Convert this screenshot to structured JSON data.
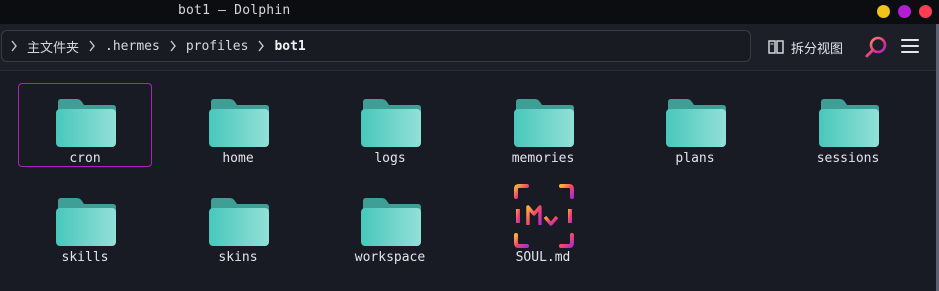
{
  "window": {
    "title": "bot1 — Dolphin",
    "controls": [
      "minimize",
      "maximize",
      "close"
    ],
    "colors": {
      "minimize": "#f2c318",
      "maximize": "#b21fd3",
      "close": "#ff3d52"
    }
  },
  "breadcrumb": {
    "segments": [
      "主文件夹",
      ".hermes",
      "profiles",
      "bot1"
    ]
  },
  "toolbar": {
    "split_label": "拆分视图",
    "search_icon": "magnifier-icon",
    "menu_icon": "hamburger-icon"
  },
  "files": [
    {
      "name": "cron",
      "type": "folder",
      "selected": true
    },
    {
      "name": "home",
      "type": "folder"
    },
    {
      "name": "logs",
      "type": "folder"
    },
    {
      "name": "memories",
      "type": "folder"
    },
    {
      "name": "plans",
      "type": "folder"
    },
    {
      "name": "sessions",
      "type": "folder"
    },
    {
      "name": "skills",
      "type": "folder"
    },
    {
      "name": "skins",
      "type": "folder"
    },
    {
      "name": "workspace",
      "type": "folder"
    },
    {
      "name": "SOUL.md",
      "type": "markdown"
    }
  ],
  "colors": {
    "accent_selection": "#a726b6",
    "folder_front": "#5fd3c8",
    "folder_back": "#3fa79c"
  }
}
